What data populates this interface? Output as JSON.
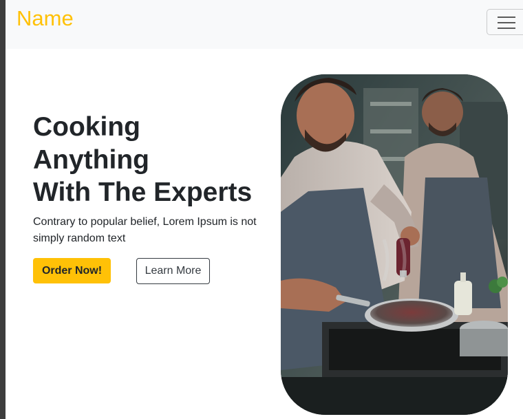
{
  "navbar": {
    "brand": "Name",
    "toggler_icon": "hamburger-menu-icon"
  },
  "hero": {
    "title_lines": [
      "Cooking",
      "Anything",
      "With The Experts"
    ],
    "text": "Contrary to popular belief, Lorem Ipsum is not simply random text",
    "order_button": "Order Now!",
    "learn_button": "Learn More",
    "image_subject": "two chefs cooking in a kitchen, one searing food in a pan"
  },
  "colors": {
    "brand": "#ffc107",
    "accent": "#ffc107",
    "text": "#212529",
    "navbar_bg": "#f8f9fa"
  }
}
